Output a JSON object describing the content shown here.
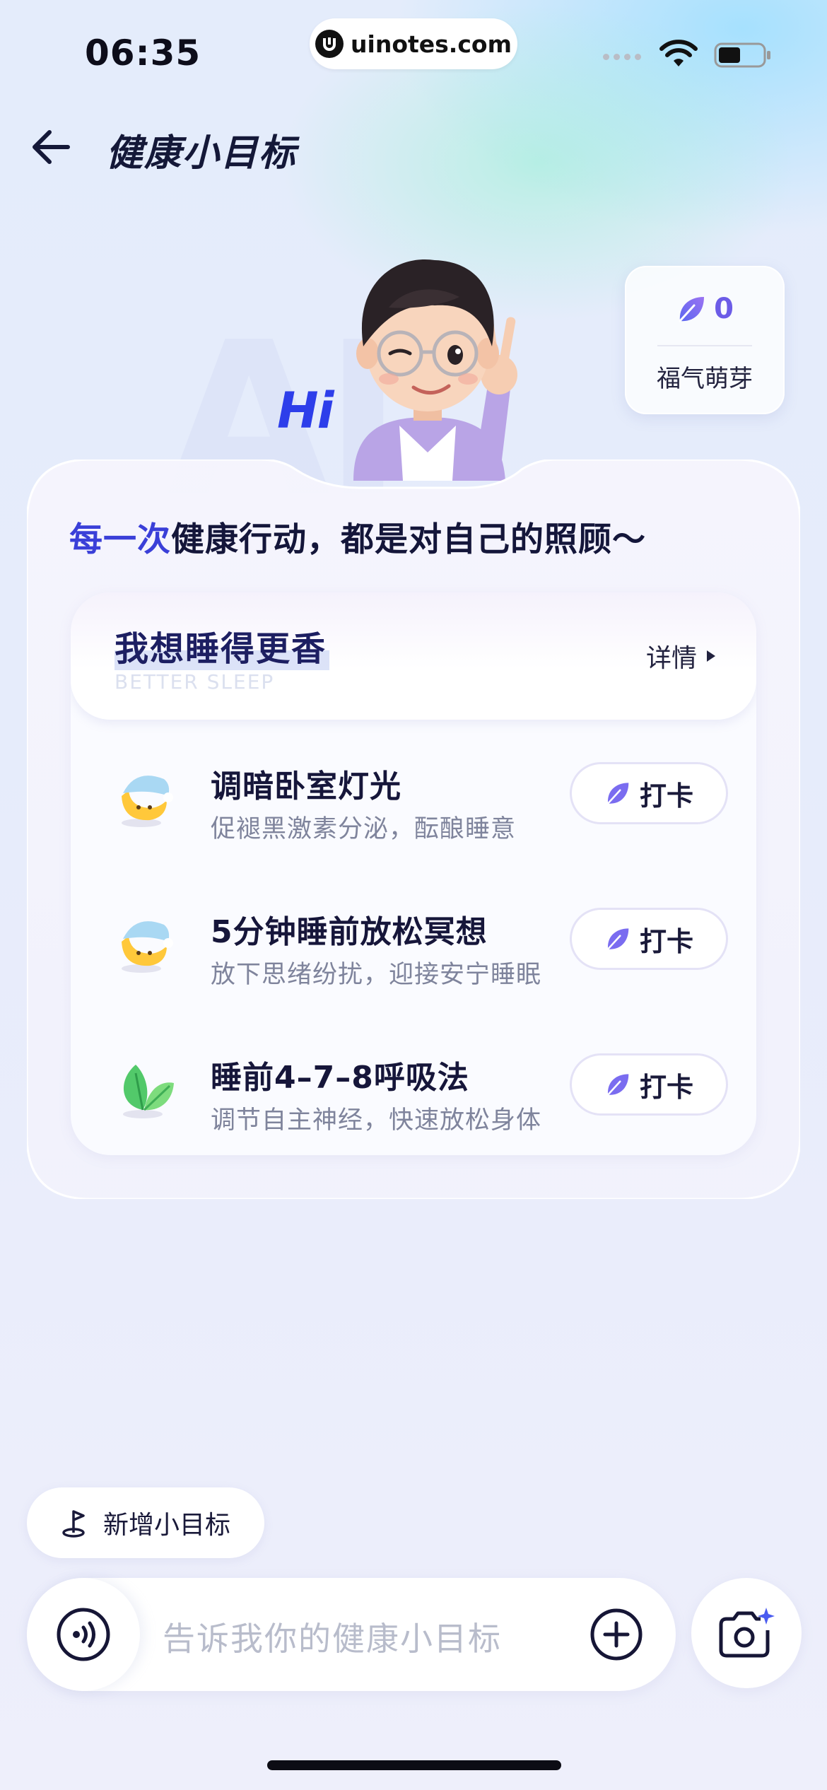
{
  "status": {
    "time": "06:35",
    "url": "uinotes.com"
  },
  "header": {
    "title": "健康小目标"
  },
  "points": {
    "value": "0",
    "label": "福气萌芽"
  },
  "hero": {
    "watermark": "AI",
    "greeting": "Hi"
  },
  "slogan": {
    "highlight": "每一次",
    "rest": "健康行动，都是对自己的照顾～"
  },
  "goal": {
    "title": "我想睡得更香",
    "subtitle": "BETTER SLEEP",
    "detail_label": "详情",
    "tasks": [
      {
        "name": "调暗卧室灯光",
        "desc": "促褪黑激素分泌，酝酿睡意",
        "icon": "moon-sleep-icon",
        "button": "打卡"
      },
      {
        "name": "5分钟睡前放松冥想",
        "desc": "放下思绪纷扰，迎接安宁睡眠",
        "icon": "moon-sleep-icon",
        "button": "打卡"
      },
      {
        "name": "睡前4–7–8呼吸法",
        "desc": "调节自主神经，快速放松身体",
        "icon": "leaf-icon",
        "button": "打卡"
      }
    ]
  },
  "bottom": {
    "new_goal_label": "新增小目标",
    "input_placeholder": "告诉我你的健康小目标"
  },
  "colors": {
    "accent": "#6c5ce7",
    "title_dark": "#1d1f62",
    "highlight": "#3a3fd8"
  }
}
